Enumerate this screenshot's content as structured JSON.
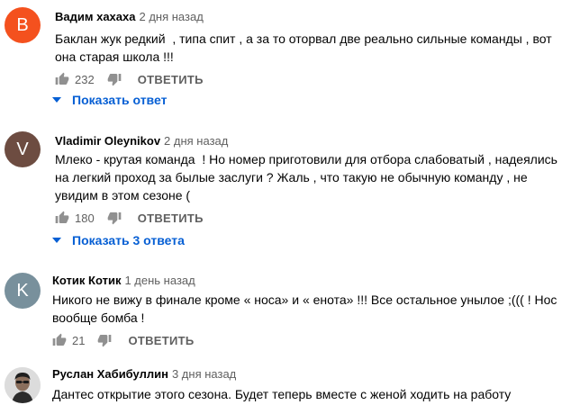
{
  "comments": [
    {
      "avatar_letter": "B",
      "avatar_color": "#f4511e",
      "author": "Вадим хахаха",
      "date": "2 дня назад",
      "text": "Баклан жук редкий  , типа спит , а за то оторвал две реально сильные команды , вот она старая школа !!!",
      "likes": "232",
      "reply_label": "ОТВЕТИТЬ",
      "show_replies": "Показать ответ"
    },
    {
      "avatar_letter": "V",
      "avatar_color": "#6d4c41",
      "author": "Vladimir Oleynikov",
      "date": "2 дня назад",
      "text": "Млеко - крутая команда  ! Но номер приготовили для отбора слабоватый , надеялись на легкий проход за былые заслуги ? Жаль , что такую не обычную команду , не увидим в этом сезоне (",
      "likes": "180",
      "reply_label": "ОТВЕТИТЬ",
      "show_replies": "Показать 3 ответа"
    },
    {
      "avatar_letter": "K",
      "avatar_color": "#78909c",
      "author": "Котик Котик",
      "date": "1 день назад",
      "text": "Никого не вижу в финале кроме « носа» и « енота» !!! Все остальное унылое ;((( ! Нос вообще бомба !",
      "likes": "21",
      "reply_label": "ОТВЕТИТЬ"
    },
    {
      "author": "Руслан Хабибуллин",
      "date": "3 дня назад",
      "text": "Дантес открытие этого сезона. Будет теперь вместе с женой ходить на работу"
    }
  ],
  "colors": {
    "link": "#065fd4",
    "secondary_text": "#606060",
    "icon": "#909090"
  },
  "icons": {
    "like": "thumb-up-icon",
    "dislike": "thumb-down-icon",
    "expand": "caret-down-icon"
  }
}
